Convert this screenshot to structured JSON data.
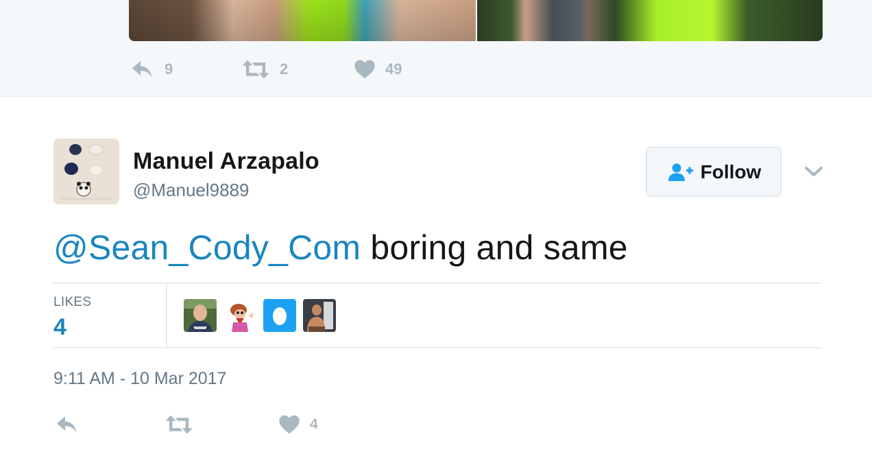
{
  "previous_tweet": {
    "actions": {
      "reply_count": "9",
      "retweet_count": "2",
      "like_count": "49"
    }
  },
  "tweet": {
    "author": {
      "name": "Manuel Arzapalo",
      "handle": "@Manuel9889"
    },
    "follow_label": "Follow",
    "text": {
      "mention": "@Sean_Cody_Com",
      "body": " boring and same"
    },
    "stats": {
      "likes_label": "LIKES",
      "likes_count": "4"
    },
    "timestamp": "9:11 AM - 10 Mar 2017",
    "actions": {
      "like_count": "4"
    }
  },
  "icons": {
    "reply": "reply-icon",
    "retweet": "retweet-icon",
    "like": "heart-icon",
    "follow": "add-person-icon",
    "more": "chevron-down-icon"
  },
  "colors": {
    "link": "#1a85c0",
    "muted": "#aab8c2",
    "secondary_text": "#657786",
    "follow_icon": "#1da1f2",
    "egg_avatar": "#1da1f2"
  }
}
